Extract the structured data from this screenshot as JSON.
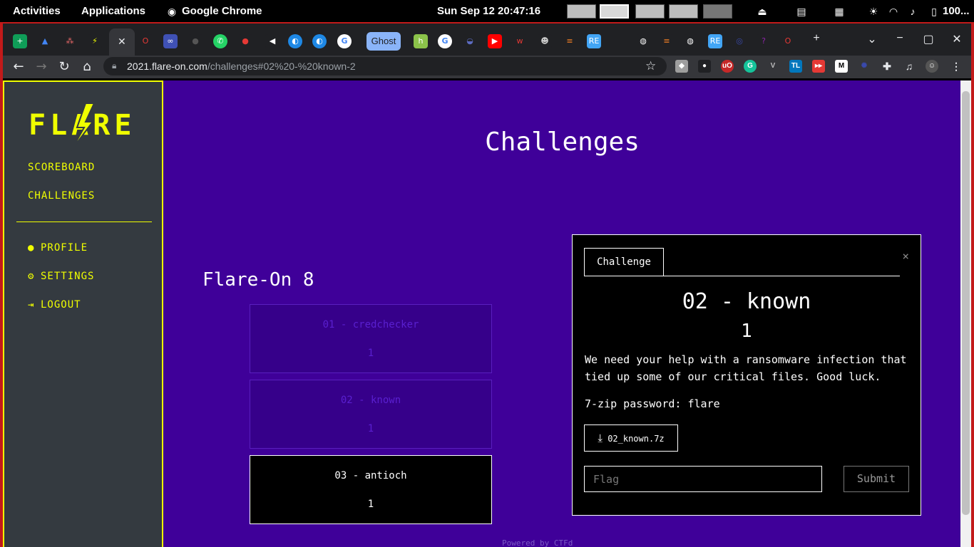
{
  "system_bar": {
    "activities": "Activities",
    "applications": "Applications",
    "app_name": "Google Chrome",
    "clock": "Sun Sep 12  20:47:16",
    "battery": "100..."
  },
  "browser": {
    "ghost_tab_label": "Ghost",
    "url_host": "2021.flare-on.com",
    "url_path": "/challenges#02%20-%20known-2"
  },
  "sidebar": {
    "logo_text": "FLARE",
    "nav": [
      {
        "label": "SCOREBOARD"
      },
      {
        "label": "CHALLENGES"
      }
    ],
    "account": [
      {
        "label": "PROFILE",
        "icon": "user-circle-icon"
      },
      {
        "label": "SETTINGS",
        "icon": "cogs-icon"
      },
      {
        "label": "LOGOUT",
        "icon": "sign-out-icon"
      }
    ]
  },
  "main": {
    "title": "Challenges",
    "category": "Flare-On 8",
    "challenges": [
      {
        "name": "01 - credchecker",
        "value": "1",
        "state": "solved"
      },
      {
        "name": "02 - known",
        "value": "1",
        "state": "solved"
      },
      {
        "name": "03 - antioch",
        "value": "1",
        "state": "unsolved"
      }
    ],
    "footer": "Powered by CTFd"
  },
  "modal": {
    "tab_label": "Challenge",
    "close_symbol": "×",
    "name": "02 - known",
    "value": "1",
    "description": "We need your help with a ransomware infection that tied up some of our critical files. Good luck.",
    "zip_password": "7-zip password: flare",
    "download_label": "02_known.7z",
    "flag_placeholder": "Flag",
    "submit_label": "Submit"
  },
  "colors": {
    "page_bg": "#3f0099",
    "accent": "#f0ff00",
    "sidebar_bg": "#343a40"
  }
}
